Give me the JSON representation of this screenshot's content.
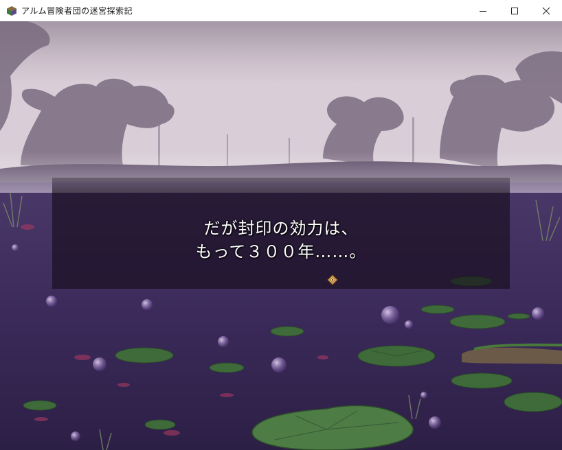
{
  "window": {
    "title": "アルム冒険者団の迷宮探索記",
    "app_icon": "game-app-icon",
    "controls": [
      "minimize-icon",
      "maximize-icon",
      "close-icon"
    ]
  },
  "scene": {
    "setting": "misty purple swamp",
    "colors": {
      "sky": "#d8cdd6",
      "water": "#3b2a5a",
      "lilypad": "#3f6a3a",
      "tree": "#6b5a72"
    }
  },
  "message": {
    "lines": [
      "だが封印の効力は、",
      "もって３００年……。"
    ],
    "continue_icon": "diamond-continue-icon"
  }
}
